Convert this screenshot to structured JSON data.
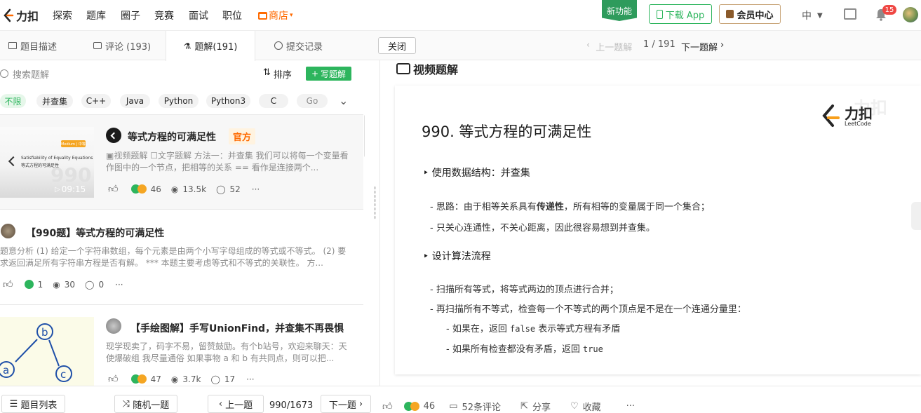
{
  "nav": {
    "logo_text": "力扣",
    "items": [
      "探索",
      "题库",
      "圈子",
      "竞赛",
      "面试",
      "职位"
    ],
    "store": "商店",
    "new_feature": "新功能",
    "download_app": "下载 App",
    "vip_center": "会员中心",
    "lang": "中",
    "notification_count": "15"
  },
  "tabs": {
    "desc": "题目描述",
    "comments": "评论 (193)",
    "solutions": "题解(191)",
    "submissions": "提交记录",
    "close": "关闭",
    "prev_solution": "上一题解",
    "page": "1 / 191",
    "next_solution": "下一题解"
  },
  "left": {
    "search_placeholder": "搜索题解",
    "sort": "排序",
    "write": "写题解",
    "filters": [
      "不限",
      "并查集",
      "C++",
      "Java",
      "Python",
      "Python3",
      "C",
      "Go"
    ],
    "thumb1": {
      "badge": "Medium | 中等",
      "en": "Satisfiability of Equality Equations",
      "cn": "等式方程的可满足性",
      "num": "990",
      "duration": "09:15"
    },
    "sol1": {
      "title": "等式方程的可满足性",
      "official": "官方",
      "video_tag": "视频题解",
      "text_tag": "文字题解",
      "desc": "方法一：并查集 我们可以将每一个变量看作图中的一个节点，把相等的关系 == 看作是连接两个...",
      "likes": "46",
      "views": "13.5k",
      "comments": "52"
    },
    "sol2": {
      "title": "【990题】等式方程的可满足性",
      "desc": "题意分析 (1) 给定一个字符串数组，每个元素是由两个小写字母组成的等式或不等式。 (2) 要求返回满足所有字符串方程是否有解。 *** 本题主要考虑等式和不等式的关联性。 方...",
      "likes": "1",
      "views": "30",
      "comments": "0"
    },
    "thumb3": {
      "b": "b",
      "a": "a",
      "c": "c"
    },
    "sol3": {
      "title": "【手绘图解】手写UnionFind，并查集不再畏惧",
      "desc": "现学现卖了，码字不易，留赞鼓励。有个b站号，欢迎来聊天：天使爆破组 我尽量通俗 如果事物 a 和 b 有共同点，则可以把...",
      "likes": "47",
      "views": "3.7k",
      "comments": "17"
    }
  },
  "right": {
    "video_header": "视频题解",
    "slide": {
      "heading": "990. 等式方程的可满足性",
      "brand_cn": "力扣",
      "brand_en": "LeetCode",
      "watermark": "力扣",
      "sec1": "使用数据结构：并查集",
      "s1_l1_pre": "思路：由于相等关系具有",
      "s1_l1_bold": "传递性",
      "s1_l1_post": "，所有相等的变量属于同一个集合；",
      "s1_l2": "只关心连通性，不关心距离，因此很容易想到并查集。",
      "sec2": "设计算法流程",
      "s2_l1": "扫描所有等式，将等式两边的顶点进行合并；",
      "s2_l2": "再扫描所有不等式，检查每一个不等式的两个顶点是不是在一个连通分量里：",
      "s2_l3_pre": "如果在，返回 ",
      "s2_l3_code": "false",
      "s2_l3_post": " 表示等式方程有矛盾",
      "s2_l4_pre": "如果所有检查都没有矛盾，返回 ",
      "s2_l4_code": "true"
    }
  },
  "bottom": {
    "problem_list": "题目列表",
    "random": "随机一题",
    "prev": "上一题",
    "pos": "990/1673",
    "next": "下一题",
    "likes": "46",
    "comments": "52条评论",
    "share": "分享",
    "favorite": "收藏",
    "more": "···"
  },
  "colors": {
    "accent": "#ff6a00",
    "green": "#2db55d",
    "link": "#262626"
  }
}
